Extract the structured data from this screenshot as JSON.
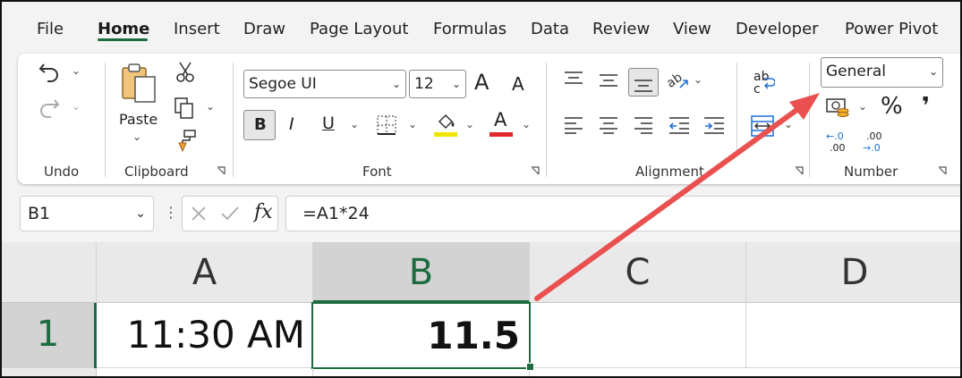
{
  "menu": {
    "items": [
      "File",
      "Home",
      "Insert",
      "Draw",
      "Page Layout",
      "Formulas",
      "Data",
      "Review",
      "View",
      "Developer",
      "Power Pivot"
    ],
    "active": "Home"
  },
  "ribbon": {
    "groups": {
      "undo": "Undo",
      "clipboard": "Clipboard",
      "font": "Font",
      "alignment": "Alignment",
      "number": "Number"
    },
    "paste_label": "Paste",
    "font_name": "Segoe UI",
    "font_size": "12",
    "bold": "B",
    "italic": "I",
    "underline": "U",
    "grow_font": "A",
    "shrink_font": "A",
    "font_color_letter": "A",
    "number_format": "General",
    "percent": "%",
    "comma": "❜",
    "inc_decimal_top": "←.0",
    "inc_decimal_bottom": ".00",
    "dec_decimal_top": ".00",
    "dec_decimal_bottom": "→.0",
    "wrap_text": "ab",
    "wrap_text_2": "c"
  },
  "formula_bar": {
    "name_box": "B1",
    "fx": "fx",
    "formula": "=A1*24"
  },
  "grid": {
    "columns": [
      "A",
      "B",
      "C",
      "D"
    ],
    "active_column": "B",
    "rows": [
      "1"
    ],
    "cells": {
      "A1": "11:30 AM",
      "B1": "11.5"
    },
    "selected_cell": "B1"
  },
  "colors": {
    "accent": "#1e6b40",
    "highlight": "#f0e500",
    "font_color": "#e0282c",
    "arrow": "#e9504f"
  },
  "icons": [
    "undo-icon",
    "redo-icon",
    "paste-icon",
    "cut-icon",
    "copy-icon",
    "format-painter-icon",
    "borders-icon",
    "fill-color-icon",
    "font-color-icon",
    "align-top-icon",
    "align-middle-icon",
    "align-bottom-icon",
    "orientation-icon",
    "align-left-icon",
    "align-center-icon",
    "align-right-icon",
    "decrease-indent-icon",
    "increase-indent-icon",
    "wrap-text-icon",
    "merge-center-icon",
    "accounting-format-icon",
    "cancel-icon",
    "enter-icon"
  ]
}
